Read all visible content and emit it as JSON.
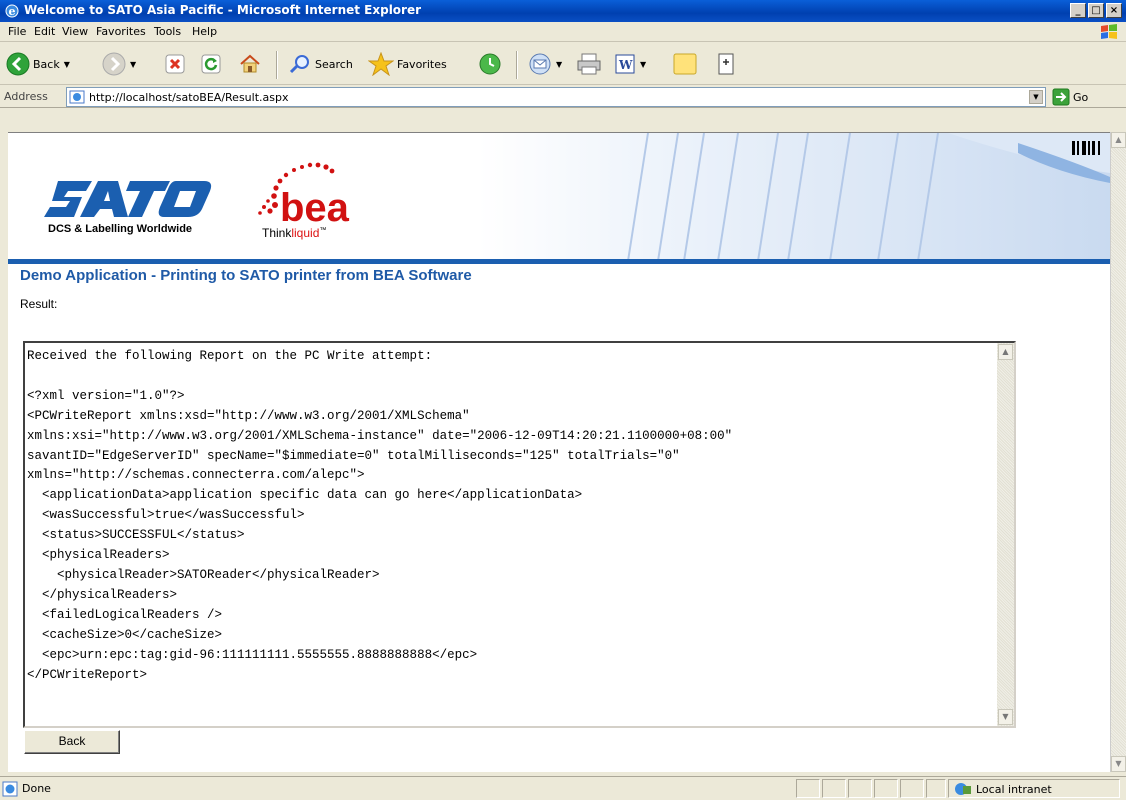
{
  "window": {
    "title": "Welcome to SATO Asia Pacific - Microsoft Internet Explorer",
    "minimize": "_",
    "maximize": "□",
    "close": "×"
  },
  "menu": [
    "File",
    "Edit",
    "View",
    "Favorites",
    "Tools",
    "Help"
  ],
  "toolbar": {
    "back_label": "Back",
    "search_label": "Search",
    "favorites_label": "Favorites"
  },
  "address": {
    "label": "Address",
    "url": "http://localhost/satoBEA/Result.aspx",
    "go_label": "Go"
  },
  "page": {
    "sato_tagline": "DCS & Labelling Worldwide",
    "bea_logo_text": "bea",
    "bea_think": "Think",
    "bea_liquid": "liquid",
    "bea_tm": "™",
    "heading": "Demo Application - Printing to SATO printer from BEA Software",
    "result_label": "Result:",
    "report_text": "Received the following Report on the PC Write attempt:\n\n<?xml version=\"1.0\"?>\n<PCWriteReport xmlns:xsd=\"http://www.w3.org/2001/XMLSchema\"\nxmlns:xsi=\"http://www.w3.org/2001/XMLSchema-instance\" date=\"2006-12-09T14:20:21.1100000+08:00\"\nsavantID=\"EdgeServerID\" specName=\"$immediate=0\" totalMilliseconds=\"125\" totalTrials=\"0\"\nxmlns=\"http://schemas.connecterra.com/alepc\">\n  <applicationData>application specific data can go here</applicationData>\n  <wasSuccessful>true</wasSuccessful>\n  <status>SUCCESSFUL</status>\n  <physicalReaders>\n    <physicalReader>SATOReader</physicalReader>\n  </physicalReaders>\n  <failedLogicalReaders />\n  <cacheSize>0</cacheSize>\n  <epc>urn:epc:tag:gid-96:111111111.5555555.8888888888</epc>\n</PCWriteReport>",
    "back_button": "Back"
  },
  "status": {
    "text": "Done",
    "zone": "Local intranet"
  },
  "colors": {
    "heading": "#1f5aa7",
    "sato_blue": "#1b5fb0",
    "bea_red": "#d11111",
    "titlebar": "#0040b0"
  }
}
